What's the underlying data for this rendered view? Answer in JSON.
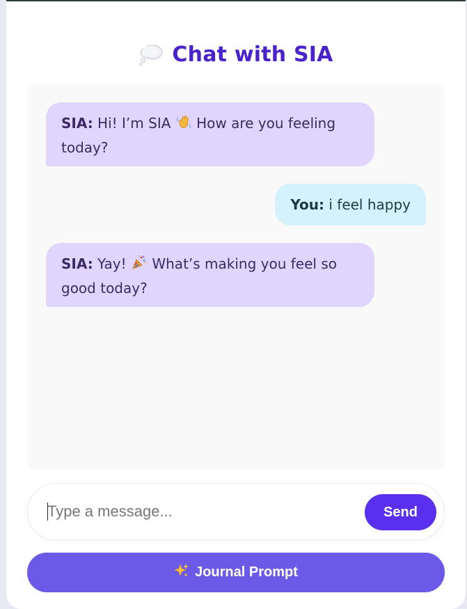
{
  "header": {
    "icon": "thought-balloon-icon",
    "title": "Chat with SIA"
  },
  "messages": [
    {
      "sender": "SIA:",
      "text_before": " Hi! I’m SIA ",
      "emoji": "waving-hand-icon",
      "text_after": " How are you feeling today?"
    },
    {
      "sender": "You:",
      "text": " i feel happy"
    },
    {
      "sender": "SIA:",
      "text_before": " Yay! ",
      "emoji": "party-popper-icon",
      "text_after": " What’s making you feel so good today?"
    }
  ],
  "composer": {
    "placeholder": "Type a message...",
    "value": "",
    "send_label": "Send"
  },
  "journal": {
    "icon": "sparkles-icon",
    "label": "Journal Prompt"
  },
  "colors": {
    "accent": "#4a22c9",
    "send": "#5a2ff0",
    "journal": "#6b5ae7",
    "sia_bubble": "#e0d6fd",
    "user_bubble": "#d3f2fb"
  }
}
